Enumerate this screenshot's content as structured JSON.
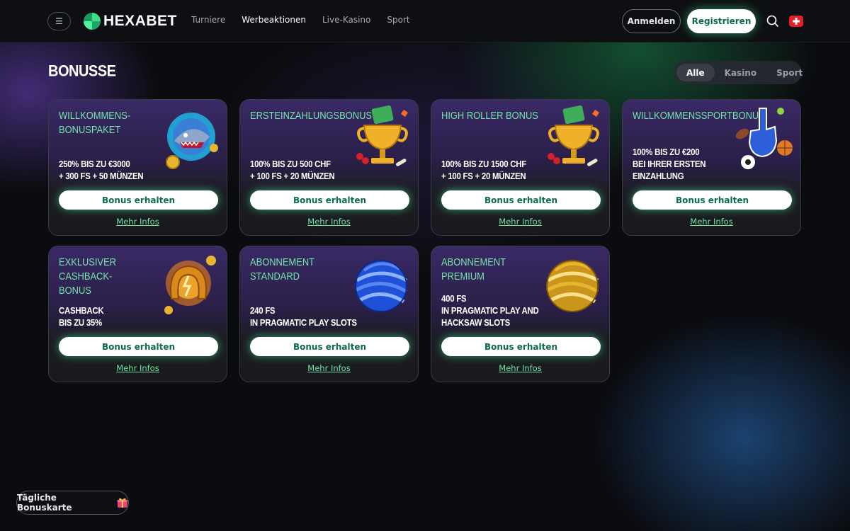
{
  "header": {
    "logo_text": "HEXABET",
    "nav": [
      {
        "label": "Turniere",
        "active": false
      },
      {
        "label": "Werbeaktionen",
        "active": true
      },
      {
        "label": "Live-Kasino",
        "active": false
      },
      {
        "label": "Sport",
        "active": false
      }
    ],
    "login_label": "Anmelden",
    "register_label": "Registrieren",
    "menu_icon": "hamburger-icon",
    "search_icon": "search-icon",
    "flag_icon": "swiss-flag-icon"
  },
  "page": {
    "title": "BONUSSE",
    "filters": [
      {
        "label": "Alle",
        "active": true
      },
      {
        "label": "Kasino",
        "active": false
      },
      {
        "label": "Sport",
        "active": false
      }
    ]
  },
  "cards": [
    {
      "title": "WILLKOMMENS-\nBONUSPAKET",
      "offer": "250% BIS ZU €3000\n+ 300 FS + 50 MÜNZEN",
      "button": "Bonus erhalten",
      "more": "Mehr Infos",
      "art": "shark-icon"
    },
    {
      "title": "ERSTEINZAHLUNGSBONUS",
      "offer": "100% BIS ZU 500 CHF\n+ 100 FS + 20 MÜNZEN",
      "button": "Bonus erhalten",
      "more": "Mehr Infos",
      "art": "trophy-icon"
    },
    {
      "title": "HIGH ROLLER BONUS",
      "offer": "100% BIS ZU 1500 CHF\n+ 100 FS + 20 MÜNZEN",
      "button": "Bonus erhalten",
      "more": "Mehr Infos",
      "art": "trophy-icon"
    },
    {
      "title": "WILLKOMMENSSPORTBONU",
      "offer": "100% BIS ZU €200\nBEI IHRER ERSTEN\nEINZAHLUNG",
      "button": "Bonus erhalten",
      "more": "Mehr Infos",
      "art": "foam-finger-icon"
    },
    {
      "title": "EXKLUSIVER CASHBACK-\nBONUS",
      "offer": "CASHBACK\nBIS ZU 35%",
      "button": "Bonus erhalten",
      "more": "Mehr Infos",
      "art": "horseshoe-icon"
    },
    {
      "title": "ABONNEMENT STANDARD",
      "offer": "240 FS\nIN PRAGMATIC PLAY SLOTS",
      "button": "Bonus erhalten",
      "more": "Mehr Infos",
      "art": "blue-sphere-icon"
    },
    {
      "title": "ABONNEMENT PREMIUM",
      "offer": "400 FS\nIN PRAGMATIC PLAY AND\nHACKSAW SLOTS",
      "button": "Bonus erhalten",
      "more": "Mehr Infos",
      "art": "gold-sphere-icon"
    }
  ],
  "daily_card": {
    "label": "Tägliche Bonuskarte",
    "icon": "gift-icon"
  },
  "colors": {
    "accent_green": "#73e6a8",
    "button_text": "#0d6b4a",
    "background": "#0b0c10"
  }
}
